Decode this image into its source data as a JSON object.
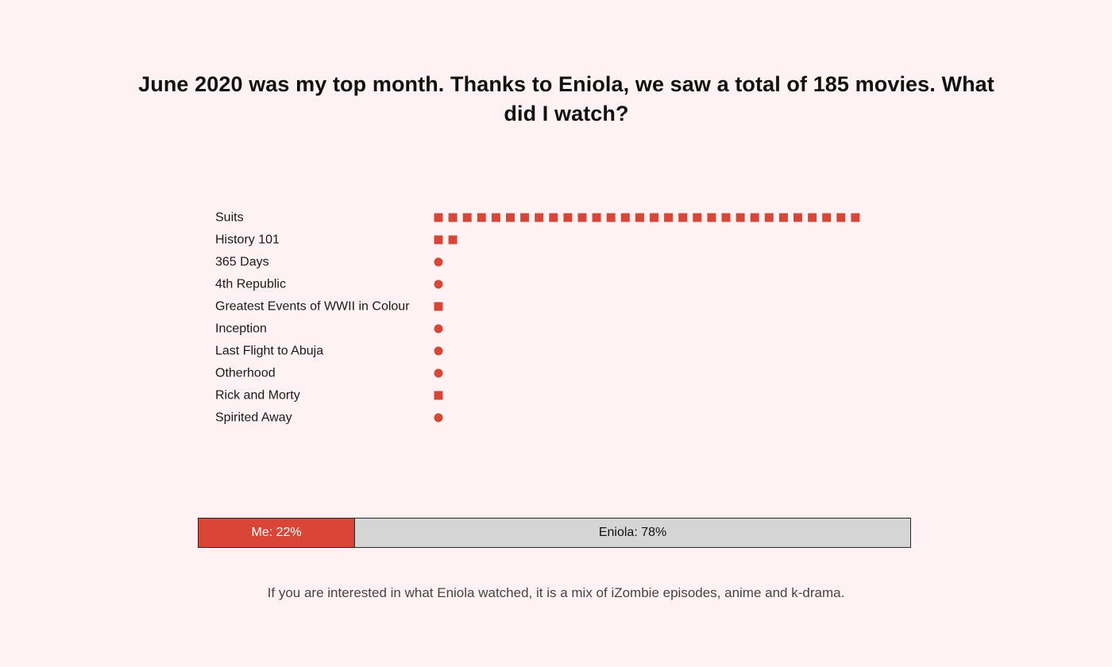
{
  "title": "June 2020 was my top month. Thanks to Eniola, we saw a total of 185 movies. What did I watch?",
  "colors": {
    "accent": "#d94636",
    "neutral": "#d6d6d6",
    "background": "#fff2f2"
  },
  "chart_data": {
    "type": "bar",
    "categories": [
      "Suits",
      "History 101",
      "365 Days",
      "4th Republic",
      "Greatest Events of WWII in Colour",
      "Inception",
      "Last Flight to Abuja",
      "Otherhood",
      "Rick and Morty",
      "Spirited Away"
    ],
    "values": [
      30,
      2,
      1,
      1,
      1,
      1,
      1,
      1,
      1,
      1
    ],
    "shapes": [
      "square",
      "square",
      "circle",
      "circle",
      "square",
      "circle",
      "circle",
      "circle",
      "square",
      "circle"
    ],
    "title": "June 2020 was my top month. Thanks to Eniola, we saw a total of 185 movies. What did I watch?",
    "xlabel": "",
    "ylabel": "",
    "grid": false
  },
  "split": {
    "me_label": "Me: 22%",
    "me_fraction": 0.22,
    "eniola_label": "Eniola: 78%",
    "eniola_fraction": 0.78
  },
  "footnote": "If you are interested in what Eniola watched, it is a mix of iZombie episodes, anime and k-drama."
}
